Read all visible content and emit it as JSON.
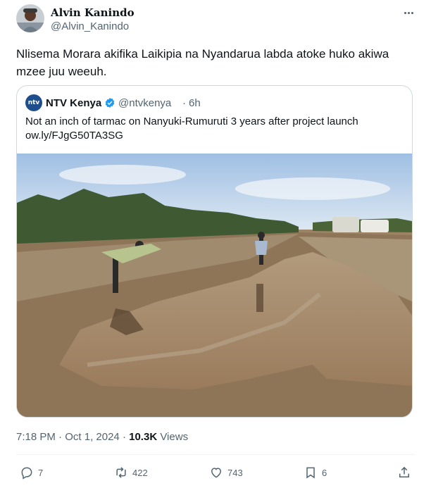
{
  "author": {
    "name": "Alvin Kanindo",
    "handle": "@Alvin_Kanindo"
  },
  "tweet": {
    "text": "Nlisema Morara akifika Laikipia na Nyandarua labda atoke huko akiwa mzee juu weeuh."
  },
  "quoted": {
    "avatar_text": "ntv",
    "name": "NTV Kenya",
    "handle": "@ntvkenya",
    "separator": "·",
    "time": "6h",
    "text_line1": "Not an inch of tarmac on Nanyuki-Rumuruti 3 years after project launch",
    "text_line2": "ow.ly/FJgG50TA3SG"
  },
  "meta": {
    "time": "7:18 PM",
    "separator": "·",
    "date": "Oct 1, 2024",
    "views_count": "10.3K",
    "views_label": "Views"
  },
  "actions": {
    "replies": "7",
    "reposts": "422",
    "likes": "743",
    "bookmarks": "6"
  },
  "colors": {
    "text": "#0f1419",
    "secondary": "#536471",
    "border": "#cfd9de",
    "verified": "#1d9bf0"
  },
  "icons": [
    "more-icon",
    "verified-icon",
    "reply-icon",
    "repost-icon",
    "like-icon",
    "bookmark-icon",
    "share-icon"
  ]
}
